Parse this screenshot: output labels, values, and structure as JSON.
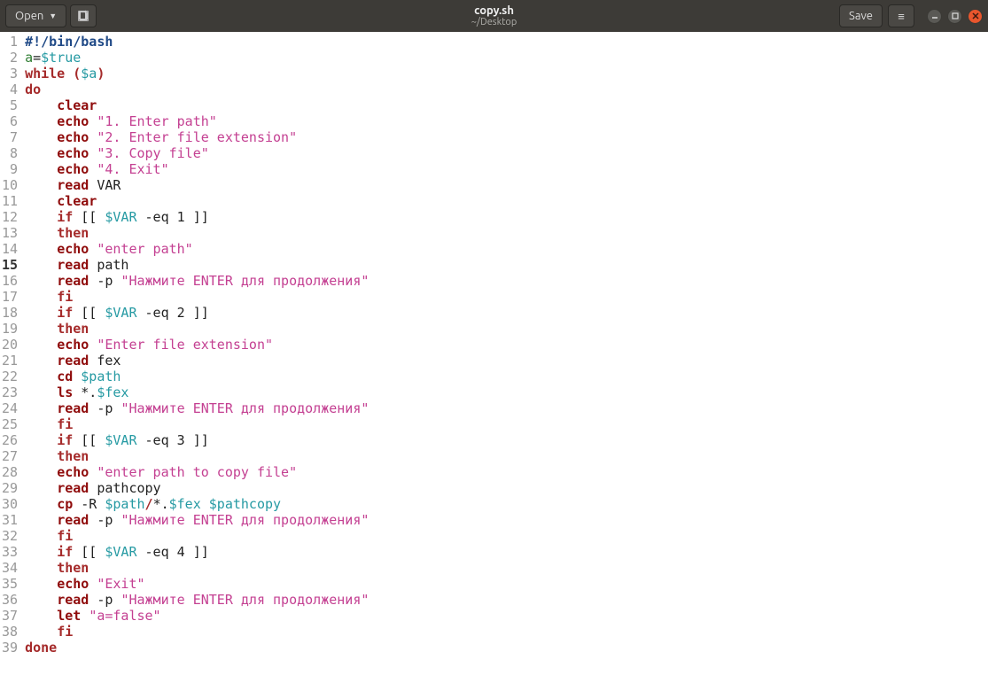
{
  "titlebar": {
    "open_label": "Open",
    "save_label": "Save",
    "filename": "copy.sh",
    "filepath": "~/Desktop"
  },
  "code": {
    "lines": [
      {
        "n": 1,
        "tokens": [
          {
            "c": "c-sh",
            "t": "#!/bin/bash"
          }
        ]
      },
      {
        "n": 2,
        "tokens": [
          {
            "c": "c-var",
            "t": "a"
          },
          {
            "c": "c-txt",
            "t": "="
          },
          {
            "c": "c-bool",
            "t": "$true"
          }
        ]
      },
      {
        "n": 3,
        "tokens": [
          {
            "c": "c-kw",
            "t": "while"
          },
          {
            "c": "c-txt",
            "t": " "
          },
          {
            "c": "c-kw",
            "t": "("
          },
          {
            "c": "c-dvar",
            "t": "$a"
          },
          {
            "c": "c-kw",
            "t": ")"
          }
        ]
      },
      {
        "n": 4,
        "tokens": [
          {
            "c": "c-kw",
            "t": "do"
          }
        ]
      },
      {
        "n": 5,
        "tokens": [
          {
            "c": "c-txt",
            "t": "    "
          },
          {
            "c": "c-cmd",
            "t": "clear"
          }
        ]
      },
      {
        "n": 6,
        "tokens": [
          {
            "c": "c-txt",
            "t": "    "
          },
          {
            "c": "c-cmd",
            "t": "echo"
          },
          {
            "c": "c-txt",
            "t": " "
          },
          {
            "c": "c-str",
            "t": "\"1. Enter path\""
          }
        ]
      },
      {
        "n": 7,
        "tokens": [
          {
            "c": "c-txt",
            "t": "    "
          },
          {
            "c": "c-cmd",
            "t": "echo"
          },
          {
            "c": "c-txt",
            "t": " "
          },
          {
            "c": "c-str",
            "t": "\"2. Enter file extension\""
          }
        ]
      },
      {
        "n": 8,
        "tokens": [
          {
            "c": "c-txt",
            "t": "    "
          },
          {
            "c": "c-cmd",
            "t": "echo"
          },
          {
            "c": "c-txt",
            "t": " "
          },
          {
            "c": "c-str",
            "t": "\"3. Copy file\""
          }
        ]
      },
      {
        "n": 9,
        "tokens": [
          {
            "c": "c-txt",
            "t": "    "
          },
          {
            "c": "c-cmd",
            "t": "echo"
          },
          {
            "c": "c-txt",
            "t": " "
          },
          {
            "c": "c-str",
            "t": "\"4. Exit\""
          }
        ]
      },
      {
        "n": 10,
        "tokens": [
          {
            "c": "c-txt",
            "t": "    "
          },
          {
            "c": "c-cmd",
            "t": "read"
          },
          {
            "c": "c-txt",
            "t": " VAR"
          }
        ]
      },
      {
        "n": 11,
        "tokens": [
          {
            "c": "c-txt",
            "t": "    "
          },
          {
            "c": "c-cmd",
            "t": "clear"
          }
        ]
      },
      {
        "n": 12,
        "tokens": [
          {
            "c": "c-txt",
            "t": "    "
          },
          {
            "c": "c-kw",
            "t": "if"
          },
          {
            "c": "c-txt",
            "t": " [[ "
          },
          {
            "c": "c-dvar",
            "t": "$VAR"
          },
          {
            "c": "c-txt",
            "t": " -eq 1 ]]"
          }
        ]
      },
      {
        "n": 13,
        "tokens": [
          {
            "c": "c-txt",
            "t": "    "
          },
          {
            "c": "c-kw",
            "t": "then"
          }
        ]
      },
      {
        "n": 14,
        "tokens": [
          {
            "c": "c-txt",
            "t": "    "
          },
          {
            "c": "c-cmd",
            "t": "echo"
          },
          {
            "c": "c-txt",
            "t": " "
          },
          {
            "c": "c-str",
            "t": "\"enter path\""
          }
        ]
      },
      {
        "n": 15,
        "hl": true,
        "tokens": [
          {
            "c": "c-txt",
            "t": "    "
          },
          {
            "c": "c-cmd",
            "t": "read"
          },
          {
            "c": "c-txt",
            "t": " path"
          }
        ]
      },
      {
        "n": 16,
        "tokens": [
          {
            "c": "c-txt",
            "t": "    "
          },
          {
            "c": "c-cmd",
            "t": "read"
          },
          {
            "c": "c-txt",
            "t": " -p "
          },
          {
            "c": "c-str",
            "t": "\"Нажмите ENTER для продолжения\""
          }
        ]
      },
      {
        "n": 17,
        "tokens": [
          {
            "c": "c-txt",
            "t": "    "
          },
          {
            "c": "c-kw",
            "t": "fi"
          }
        ]
      },
      {
        "n": 18,
        "tokens": [
          {
            "c": "c-txt",
            "t": "    "
          },
          {
            "c": "c-kw",
            "t": "if"
          },
          {
            "c": "c-txt",
            "t": " [[ "
          },
          {
            "c": "c-dvar",
            "t": "$VAR"
          },
          {
            "c": "c-txt",
            "t": " -eq 2 ]]"
          }
        ]
      },
      {
        "n": 19,
        "tokens": [
          {
            "c": "c-txt",
            "t": "    "
          },
          {
            "c": "c-kw",
            "t": "then"
          }
        ]
      },
      {
        "n": 20,
        "tokens": [
          {
            "c": "c-txt",
            "t": "    "
          },
          {
            "c": "c-cmd",
            "t": "echo"
          },
          {
            "c": "c-txt",
            "t": " "
          },
          {
            "c": "c-str",
            "t": "\"Enter file extension\""
          }
        ]
      },
      {
        "n": 21,
        "tokens": [
          {
            "c": "c-txt",
            "t": "    "
          },
          {
            "c": "c-cmd",
            "t": "read"
          },
          {
            "c": "c-txt",
            "t": " fex"
          }
        ]
      },
      {
        "n": 22,
        "tokens": [
          {
            "c": "c-txt",
            "t": "    "
          },
          {
            "c": "c-cmd",
            "t": "cd"
          },
          {
            "c": "c-txt",
            "t": " "
          },
          {
            "c": "c-dvar",
            "t": "$path"
          }
        ]
      },
      {
        "n": 23,
        "tokens": [
          {
            "c": "c-txt",
            "t": "    "
          },
          {
            "c": "c-cmd",
            "t": "ls"
          },
          {
            "c": "c-txt",
            "t": " *."
          },
          {
            "c": "c-dvar",
            "t": "$fex"
          }
        ]
      },
      {
        "n": 24,
        "tokens": [
          {
            "c": "c-txt",
            "t": "    "
          },
          {
            "c": "c-cmd",
            "t": "read"
          },
          {
            "c": "c-txt",
            "t": " -p "
          },
          {
            "c": "c-str",
            "t": "\"Нажмите ENTER для продолжения\""
          }
        ]
      },
      {
        "n": 25,
        "tokens": [
          {
            "c": "c-txt",
            "t": "    "
          },
          {
            "c": "c-kw",
            "t": "fi"
          }
        ]
      },
      {
        "n": 26,
        "tokens": [
          {
            "c": "c-txt",
            "t": "    "
          },
          {
            "c": "c-kw",
            "t": "if"
          },
          {
            "c": "c-txt",
            "t": " [[ "
          },
          {
            "c": "c-dvar",
            "t": "$VAR"
          },
          {
            "c": "c-txt",
            "t": " -eq 3 ]]"
          }
        ]
      },
      {
        "n": 27,
        "tokens": [
          {
            "c": "c-txt",
            "t": "    "
          },
          {
            "c": "c-kw",
            "t": "then"
          }
        ]
      },
      {
        "n": 28,
        "tokens": [
          {
            "c": "c-txt",
            "t": "    "
          },
          {
            "c": "c-cmd",
            "t": "echo"
          },
          {
            "c": "c-txt",
            "t": " "
          },
          {
            "c": "c-str",
            "t": "\"enter path to copy file\""
          }
        ]
      },
      {
        "n": 29,
        "tokens": [
          {
            "c": "c-txt",
            "t": "    "
          },
          {
            "c": "c-cmd",
            "t": "read"
          },
          {
            "c": "c-txt",
            "t": " pathcopy"
          }
        ]
      },
      {
        "n": 30,
        "tokens": [
          {
            "c": "c-txt",
            "t": "    "
          },
          {
            "c": "c-cmd",
            "t": "cp"
          },
          {
            "c": "c-txt",
            "t": " -R "
          },
          {
            "c": "c-dvar",
            "t": "$path"
          },
          {
            "c": "c-kw",
            "t": "/"
          },
          {
            "c": "c-txt",
            "t": "*."
          },
          {
            "c": "c-dvar",
            "t": "$fex"
          },
          {
            "c": "c-txt",
            "t": " "
          },
          {
            "c": "c-dvar",
            "t": "$pathcopy"
          }
        ]
      },
      {
        "n": 31,
        "tokens": [
          {
            "c": "c-txt",
            "t": "    "
          },
          {
            "c": "c-cmd",
            "t": "read"
          },
          {
            "c": "c-txt",
            "t": " -p "
          },
          {
            "c": "c-str",
            "t": "\"Нажмите ENTER для продолжения\""
          }
        ]
      },
      {
        "n": 32,
        "tokens": [
          {
            "c": "c-txt",
            "t": "    "
          },
          {
            "c": "c-kw",
            "t": "fi"
          }
        ]
      },
      {
        "n": 33,
        "tokens": [
          {
            "c": "c-txt",
            "t": "    "
          },
          {
            "c": "c-kw",
            "t": "if"
          },
          {
            "c": "c-txt",
            "t": " [[ "
          },
          {
            "c": "c-dvar",
            "t": "$VAR"
          },
          {
            "c": "c-txt",
            "t": " -eq 4 ]]"
          }
        ]
      },
      {
        "n": 34,
        "tokens": [
          {
            "c": "c-txt",
            "t": "    "
          },
          {
            "c": "c-kw",
            "t": "then"
          }
        ]
      },
      {
        "n": 35,
        "tokens": [
          {
            "c": "c-txt",
            "t": "    "
          },
          {
            "c": "c-cmd",
            "t": "echo"
          },
          {
            "c": "c-txt",
            "t": " "
          },
          {
            "c": "c-str",
            "t": "\"Exit\""
          }
        ]
      },
      {
        "n": 36,
        "tokens": [
          {
            "c": "c-txt",
            "t": "    "
          },
          {
            "c": "c-cmd",
            "t": "read"
          },
          {
            "c": "c-txt",
            "t": " -p "
          },
          {
            "c": "c-str",
            "t": "\"Нажмите ENTER для продолжения\""
          }
        ]
      },
      {
        "n": 37,
        "tokens": [
          {
            "c": "c-txt",
            "t": "    "
          },
          {
            "c": "c-cmd",
            "t": "let"
          },
          {
            "c": "c-txt",
            "t": " "
          },
          {
            "c": "c-str",
            "t": "\"a=false\""
          }
        ]
      },
      {
        "n": 38,
        "tokens": [
          {
            "c": "c-txt",
            "t": "    "
          },
          {
            "c": "c-kw",
            "t": "fi"
          }
        ]
      },
      {
        "n": 39,
        "tokens": [
          {
            "c": "c-kw",
            "t": "done"
          }
        ]
      }
    ]
  }
}
